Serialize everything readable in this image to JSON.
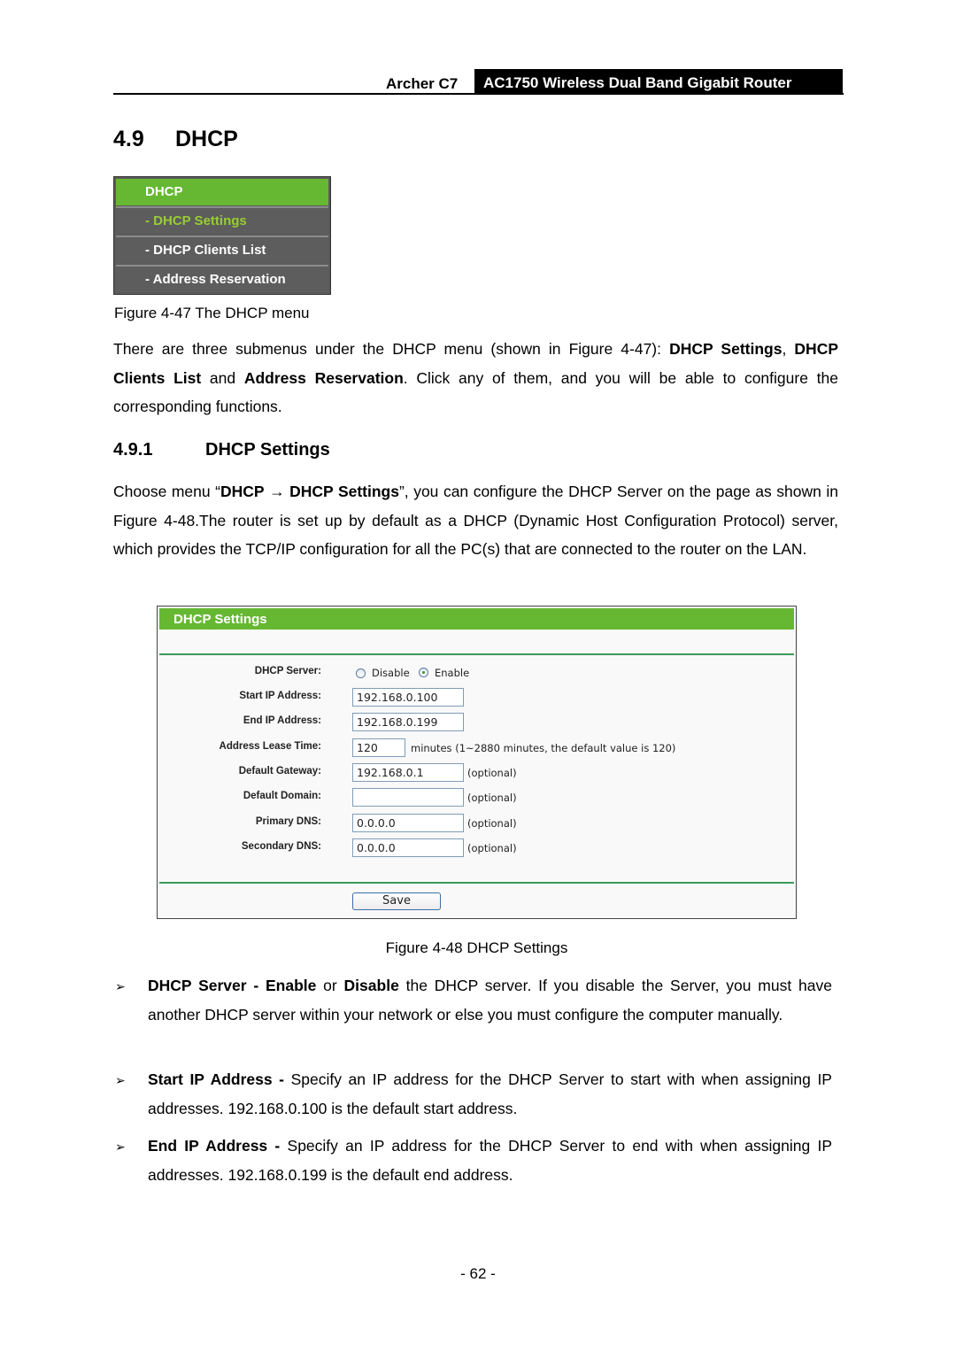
{
  "header": {
    "product": "Archer C7",
    "model_title": "AC1750 Wireless Dual Band Gigabit Router"
  },
  "section": {
    "number": "4.9",
    "title": "DHCP"
  },
  "menu_figure": {
    "head": "DHCP",
    "items": [
      "- DHCP Settings",
      "- DHCP Clients List",
      "- Address Reservation"
    ],
    "caption": "Figure 4-47 The DHCP menu"
  },
  "intro": {
    "t1": "There are three submenus under the DHCP menu (shown in Figure 4-47): ",
    "b1": "DHCP Settings",
    "t2": ", ",
    "b2": "DHCP Clients List",
    "t3": " and ",
    "b3": "Address Reservation",
    "t4": ". Click any of them, and you will be able to configure the corresponding functions."
  },
  "subsection": {
    "number": "4.9.1",
    "title": "DHCP Settings"
  },
  "choose_para": {
    "t1": "Choose menu “",
    "b1": "DHCP",
    "arrow": " → ",
    "b2": "DHCP Settings",
    "t2": "”, you can configure the DHCP Server on the page as shown in Figure 4-48.The router is set up by default as a DHCP (Dynamic Host Configuration Protocol) server, which provides the TCP/IP configuration for all the PC(s) that are connected to the router on the LAN."
  },
  "settings_figure": {
    "title": "DHCP Settings",
    "fields": {
      "dhcp_server": {
        "label": "DHCP Server:",
        "options": [
          "Disable",
          "Enable"
        ],
        "selected": "Enable"
      },
      "start_ip": {
        "label": "Start IP Address:",
        "value": "192.168.0.100"
      },
      "end_ip": {
        "label": "End IP Address:",
        "value": "192.168.0.199"
      },
      "lease_time": {
        "label": "Address Lease Time:",
        "value": "120",
        "note": "minutes (1~2880 minutes, the default value is 120)"
      },
      "gateway": {
        "label": "Default Gateway:",
        "value": "192.168.0.1",
        "note": "(optional)"
      },
      "domain": {
        "label": "Default Domain:",
        "value": "",
        "note": "(optional)"
      },
      "primary_dns": {
        "label": "Primary DNS:",
        "value": "0.0.0.0",
        "note": "(optional)"
      },
      "secondary_dns": {
        "label": "Secondary DNS:",
        "value": "0.0.0.0",
        "note": "(optional)"
      }
    },
    "save_label": "Save",
    "caption": "Figure 4-48 DHCP Settings"
  },
  "bullets": [
    {
      "b1": "DHCP Server - Enable",
      "t1": " or ",
      "b2": "Disable",
      "t2": " the DHCP server. If you disable the Server, you must have another DHCP server within your network or else you must configure the computer manually."
    },
    {
      "b1": "Start IP Address -",
      "t1": " Specify an IP address for the DHCP Server to start with when assigning IP addresses. 192.168.0.100 is the default start address."
    },
    {
      "b1": "End IP Address -",
      "t1": " Specify an IP address for the DHCP Server to end with when assigning IP addresses. 192.168.0.199 is the default end address."
    }
  ],
  "bullet_glyph": "➢",
  "page_number": "- 62 -"
}
